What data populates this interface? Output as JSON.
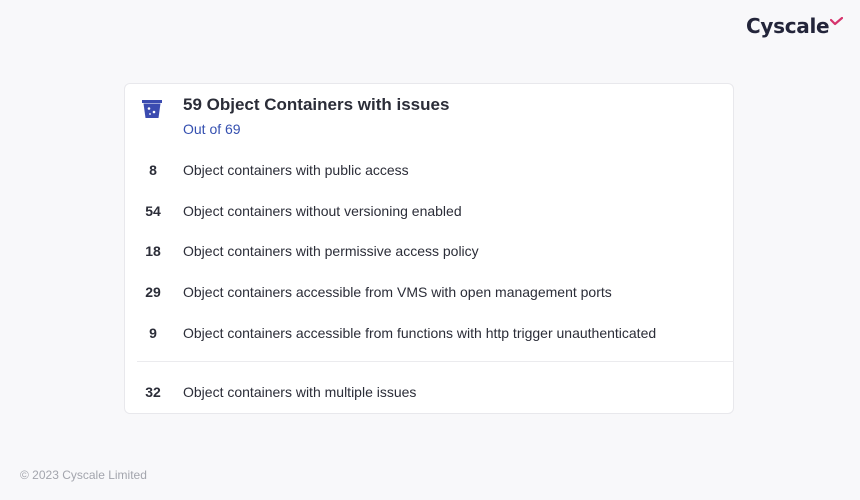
{
  "brand": {
    "name": "Cyscale",
    "accent_color": "#d6336c"
  },
  "card": {
    "icon": "bucket-icon",
    "icon_color": "#3b4bb0",
    "title": "59 Object Containers with issues",
    "subtitle": "Out of 69",
    "issues": [
      {
        "count": "8",
        "label": "Object containers with public access"
      },
      {
        "count": "54",
        "label": "Object containers without versioning enabled"
      },
      {
        "count": "18",
        "label": "Object containers with permissive access policy"
      },
      {
        "count": "29",
        "label": "Object containers accessible from VMS with open management ports"
      },
      {
        "count": "9",
        "label": "Object containers accessible from functions with http trigger unauthenticated"
      }
    ],
    "summary": {
      "count": "32",
      "label": "Object containers with multiple issues"
    }
  },
  "footer": {
    "copyright": "© 2023 Cyscale Limited"
  }
}
